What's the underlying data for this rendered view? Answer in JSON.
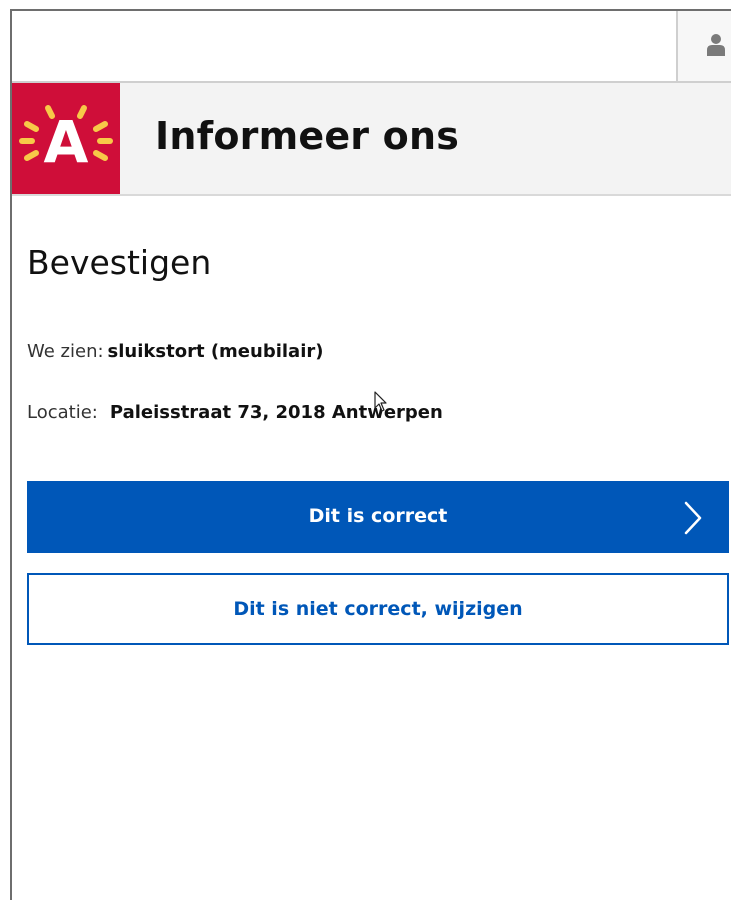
{
  "header": {
    "app_title": "Informeer ons",
    "logo_letter": "A",
    "brand_color": "#cf0e39",
    "user_icon": "user-icon"
  },
  "confirm": {
    "title": "Bevestigen",
    "what_label": "We zien:",
    "what_value": "sluikstort (meubilair)",
    "location_label": "Locatie:",
    "location_value": "Paleisstraat 73, 2018 Antwerpen"
  },
  "actions": {
    "primary_label": "Dit is correct",
    "primary_icon": "chevron-right-icon",
    "secondary_label": "Dit is niet correct, wijzigen",
    "accent_color": "#0057b8"
  }
}
